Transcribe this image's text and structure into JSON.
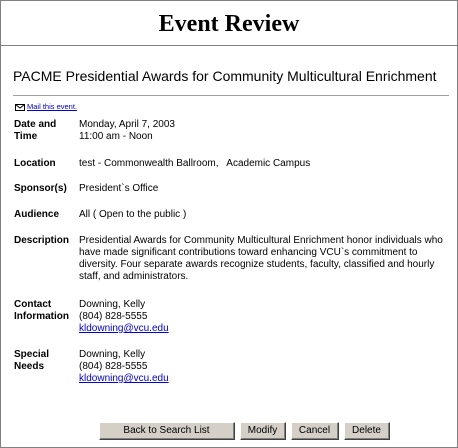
{
  "header": {
    "title": "Event Review"
  },
  "event": {
    "title": "PACME Presidential Awards for Community Multicultural Enrichment",
    "mail_link": "Mail this event."
  },
  "fields": {
    "date_label_1": "Date and",
    "date_label_2": "Time",
    "date": "Monday, April 7, 2003",
    "time": "11:00 am - Noon",
    "location_label": "Location",
    "location": "test - Commonwealth Ballroom,   Academic Campus",
    "sponsor_label": "Sponsor(s)",
    "sponsor": "President`s Office",
    "audience_label": "Audience",
    "audience": "All ( Open to the public )",
    "description_label": "Description",
    "description": "Presidential Awards for Community Multicultural Enrichment honor individuals who have made significant contributions toward enhancing VCU`s commitment to diversity. Four separate awards recognize students, faculty, classified and hourly staff, and administrators.",
    "contact_label_1": "Contact",
    "contact_label_2": "Information",
    "contact_name": "Downing, Kelly",
    "contact_phone": "(804) 828-5555",
    "contact_email": "kldowning@vcu.edu",
    "special_label_1": "Special",
    "special_label_2": "Needs",
    "special_name": "Downing, Kelly",
    "special_phone": "(804) 828-5555",
    "special_email": "kldowning@vcu.edu"
  },
  "buttons": {
    "back": "Back to Search List",
    "modify": "Modify",
    "cancel": "Cancel",
    "delete": "Delete"
  },
  "icons": {
    "mail": "envelope-icon"
  }
}
